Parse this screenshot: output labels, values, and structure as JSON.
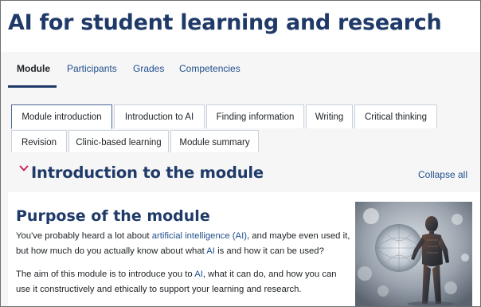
{
  "page": {
    "title": "AI for student learning and research"
  },
  "secondary_nav": {
    "items": [
      {
        "label": "Module",
        "active": true
      },
      {
        "label": "Participants",
        "active": false
      },
      {
        "label": "Grades",
        "active": false
      },
      {
        "label": "Competencies",
        "active": false
      }
    ]
  },
  "tabs": {
    "row1": [
      {
        "label": "Module introduction",
        "active": true
      },
      {
        "label": "Introduction to AI",
        "active": false
      },
      {
        "label": "Finding information",
        "active": false
      },
      {
        "label": "Writing",
        "active": false
      },
      {
        "label": "Critical thinking",
        "active": false
      }
    ],
    "row2": [
      {
        "label": "Revision",
        "active": false
      },
      {
        "label": "Clinic-based learning",
        "active": false
      },
      {
        "label": "Module summary",
        "active": false
      }
    ]
  },
  "section": {
    "title": "Introduction to the module",
    "collapse_all_label": "Collapse all",
    "chevron_icon": "chevron-down-icon",
    "chevron_color": "#c2185b"
  },
  "content": {
    "heading": "Purpose of the module",
    "para1": {
      "before": "You've probably heard a lot about ",
      "link1": "artificial intelligence (AI)",
      "middle": ", and maybe even used it, but how much do you actually know about what ",
      "link2": "AI",
      "after": " is and how it can be used?"
    },
    "para2": {
      "before": "The aim of this module is to introduce you to ",
      "link": "AI",
      "after": ", what it can do, and how you can use it constructively and ethically to support your learning and research."
    },
    "image_icon": "ai-robot-image"
  },
  "colors": {
    "title": "#1f3a68",
    "link": "#1f4e8c",
    "panel_bg": "#f6f6f6"
  }
}
